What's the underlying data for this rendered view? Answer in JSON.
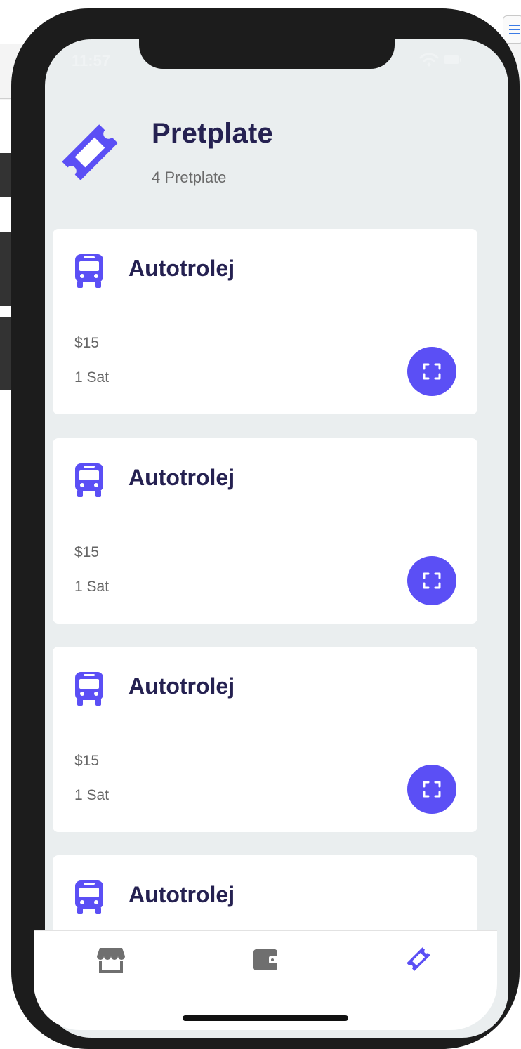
{
  "status_bar": {
    "time": "11:57",
    "icons": [
      "wifi-icon",
      "battery-icon"
    ]
  },
  "header": {
    "title": "Pretplate",
    "subtitle": "4 Pretplate",
    "icon": "ticket-icon"
  },
  "subscriptions": [
    {
      "title": "Autotrolej",
      "price": "$15",
      "duration": "1 Sat",
      "icon": "bus-icon",
      "action_icon": "scan-icon"
    },
    {
      "title": "Autotrolej",
      "price": "$15",
      "duration": "1 Sat",
      "icon": "bus-icon",
      "action_icon": "scan-icon"
    },
    {
      "title": "Autotrolej",
      "price": "$15",
      "duration": "1 Sat",
      "icon": "bus-icon",
      "action_icon": "scan-icon"
    },
    {
      "title": "Autotrolej",
      "icon": "bus-icon"
    }
  ],
  "tab_bar": {
    "tabs": [
      {
        "icon": "store-icon",
        "active": false
      },
      {
        "icon": "wallet-icon",
        "active": false
      },
      {
        "icon": "ticket-icon",
        "active": true
      }
    ]
  },
  "colors": {
    "accent": "#5b4ff5",
    "title": "#252151",
    "background": "#eaeeef",
    "inactive_icon": "#6f6f6f"
  }
}
